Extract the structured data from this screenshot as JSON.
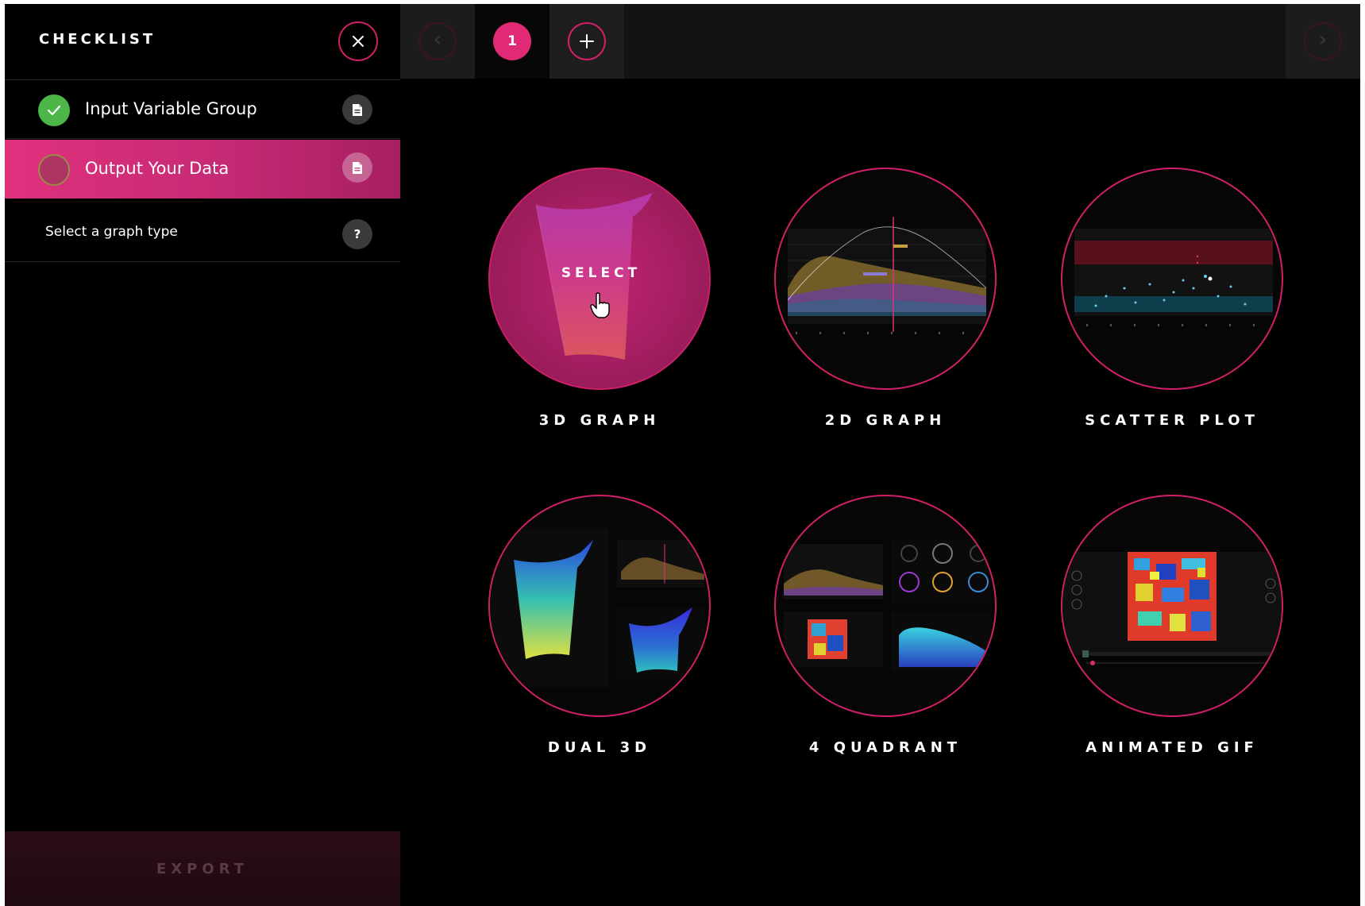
{
  "sidebar": {
    "title": "CHECKLIST",
    "steps": [
      {
        "label": "Input Variable Group",
        "status": "complete"
      },
      {
        "label": "Output Your Data",
        "status": "active"
      }
    ],
    "hint": "Select a graph type",
    "help_glyph": "?",
    "export_label": "EXPORT"
  },
  "tabs": {
    "active_tab": "1",
    "prev_glyph": "‹",
    "next_glyph": "›"
  },
  "graphs": [
    {
      "label": "3D GRAPH",
      "hover_text": "SELECT",
      "icon": "3d-surface-preview"
    },
    {
      "label": "2D GRAPH",
      "icon": "2d-line-preview"
    },
    {
      "label": "SCATTER PLOT",
      "icon": "scatter-preview"
    },
    {
      "label": "DUAL 3D",
      "icon": "dual-3d-preview"
    },
    {
      "label": "4 QUADRANT",
      "icon": "4-quadrant-preview"
    },
    {
      "label": "ANIMATED GIF",
      "icon": "animated-gif-preview"
    }
  ],
  "colors": {
    "accent": "#d21f6a",
    "active_step": "#e0317d",
    "complete": "#4cb648",
    "background": "#000000"
  }
}
